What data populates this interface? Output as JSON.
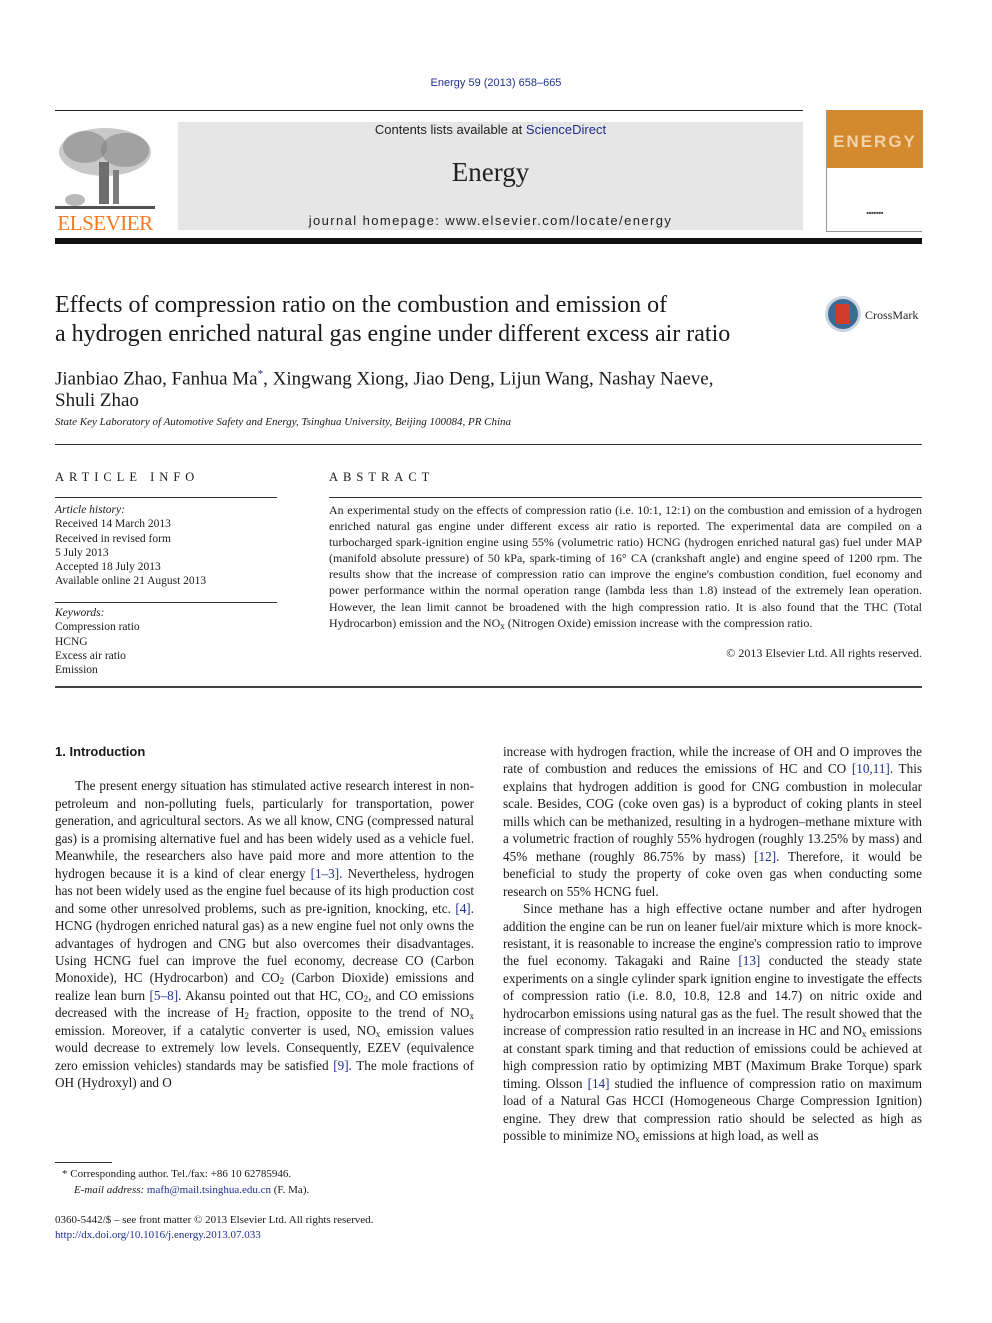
{
  "header": {
    "citation": "Energy 59 (2013) 658–665",
    "contents_prefix": "Contents lists available at ",
    "contents_link": "ScienceDirect",
    "journal_title": "Energy",
    "homepage": "journal homepage: www.elsevier.com/locate/energy",
    "publisher_logo": "ELSEVIER",
    "cover_word": "ENERGY",
    "brand_color": "#f47920",
    "cover_color": "#d3892e",
    "link_color": "#1f2f8c"
  },
  "article": {
    "title_line1": "Effects of compression ratio on the combustion and emission of",
    "title_line2": "a hydrogen enriched natural gas engine under different excess air ratio",
    "crossmark_label": "CrossMark",
    "authors_part1": "Jianbiao Zhao, Fanhua Ma",
    "corresponding_mark": "*",
    "authors_part2": ", Xingwang Xiong, Jiao Deng, Lijun Wang, Nashay Naeve,",
    "authors_line2": "Shuli Zhao",
    "affiliation": "State Key Laboratory of Automotive Safety and Energy, Tsinghua University, Beijing 100084, PR China"
  },
  "article_info": {
    "heading": "ARTICLE INFO",
    "history_label": "Article history:",
    "history": [
      "Received 14 March 2013",
      "Received in revised form",
      "5 July 2013",
      "Accepted 18 July 2013",
      "Available online 21 August 2013"
    ],
    "keywords_label": "Keywords:",
    "keywords": [
      "Compression ratio",
      "HCNG",
      "Excess air ratio",
      "Emission"
    ]
  },
  "abstract": {
    "heading": "ABSTRACT",
    "text_before_sub": "An experimental study on the effects of compression ratio (i.e. 10:1, 12:1) on the combustion and emission of a hydrogen enriched natural gas engine under different excess air ratio is reported. The experimental data are compiled on a turbocharged spark-ignition engine using 55% (volumetric ratio) HCNG (hydrogen enriched natural gas) fuel under MAP (manifold absolute pressure) of 50 kPa, spark-timing of 16° CA (crankshaft angle) and engine speed of 1200 rpm. The results show that the increase of compression ratio can improve the engine's combustion condition, fuel economy and power performance within the normal operation range (lambda less than 1.8) instead of the extremely lean operation. However, the lean limit cannot be broadened with the high compression ratio. It is also found that the THC (Total Hydrocarbon) emission and the NO",
    "sub": "x",
    "text_after_sub": " (Nitrogen Oxide) emission increase with the compression ratio.",
    "copyright": "© 2013 Elsevier Ltd. All rights reserved."
  },
  "body": {
    "section_heading": "1.  Introduction",
    "left_col": {
      "p1_a": "The present energy situation has stimulated active research interest in non-petroleum and non-polluting fuels, particularly for transportation, power generation, and agricultural sectors. As we all know, CNG (compressed natural gas) is a promising alternative fuel and has been widely used as a vehicle fuel. Meanwhile, the researchers also have paid more and more attention to the hydrogen because it is a kind of clear energy ",
      "ref1": "[1–3]",
      "p1_b": ". Nevertheless, hydrogen has not been widely used as the engine fuel because of its high production cost and some other unresolved problems, such as pre-ignition, knocking, etc. ",
      "ref2": "[4]",
      "p1_c": ". HCNG (hydrogen enriched natural gas) as a new engine fuel not only owns the advantages of hydrogen and CNG but also overcomes their disadvantages. Using HCNG fuel can improve the fuel economy, decrease CO (Carbon Monoxide), HC (Hydrocarbon) and CO",
      "p1_d": " (Carbon Dioxide) emissions and realize lean burn ",
      "ref3": "[5–8]",
      "p1_e": ". Akansu pointed out that HC, CO",
      "p1_f": ", and CO emissions decreased with the increase of H",
      "p1_g": " fraction, opposite to the trend of NO",
      "p1_h": " emission. Moreover, if a catalytic converter is used, NO",
      "p1_i": " emission values would decrease to extremely low levels. Consequently, EZEV (equivalence zero emission vehicles) standards may be satisfied ",
      "ref4": "[9]",
      "p1_j": ". The mole fractions of OH (Hydroxyl) and O",
      "sub2": "2",
      "subx": "x"
    },
    "right_col": {
      "p1_a": "increase with hydrogen fraction, while the increase of OH and O improves the rate of combustion and reduces the emissions of HC and CO ",
      "ref1": "[10,11]",
      "p1_b": ". This explains that hydrogen addition is good for CNG combustion in molecular scale. Besides, COG (coke oven gas) is a byproduct of coking plants in steel mills which can be methanized, resulting in a hydrogen–methane mixture with a volumetric fraction of roughly 55% hydrogen (roughly 13.25% by mass) and 45% methane (roughly 86.75% by mass) ",
      "ref2": "[12]",
      "p1_c": ". Therefore, it would be beneficial to study the property of coke oven gas when conducting some research on 55% HCNG fuel.",
      "p2_a": "Since methane has a high effective octane number and after hydrogen addition the engine can be run on leaner fuel/air mixture which is more knock-resistant, it is reasonable to increase the engine's compression ratio to improve the fuel economy. Takagaki and Raine ",
      "ref3": "[13]",
      "p2_b": " conducted the steady state experiments on a single cylinder spark ignition engine to investigate the effects of compression ratio (i.e. 8.0, 10.8, 12.8 and 14.7) on nitric oxide and hydrocarbon emissions using natural gas as the fuel. The result showed that the increase of compression ratio resulted in an increase in HC and NO",
      "p2_c": " emissions at constant spark timing and that reduction of emissions could be achieved at high compression ratio by optimizing MBT (Maximum Brake Torque) spark timing. Olsson ",
      "ref4": "[14]",
      "p2_d": " studied the influence of compression ratio on maximum load of a Natural Gas HCCI (Homogeneous Charge Compression Ignition) engine. They drew that compression ratio should be selected as high as possible to minimize NO",
      "p2_e": " emissions at high load, as well as",
      "subx": "x"
    }
  },
  "footer": {
    "footnote_mark": "*",
    "footnote_text": " Corresponding author. Tel./fax: +86 10 62785946.",
    "email_label": "E-mail address: ",
    "email": "mafh@mail.tsinghua.edu.cn",
    "email_suffix": " (F. Ma).",
    "front_matter": "0360-5442/$ – see front matter © 2013 Elsevier Ltd. All rights reserved.",
    "doi": "http://dx.doi.org/10.1016/j.energy.2013.07.033"
  }
}
